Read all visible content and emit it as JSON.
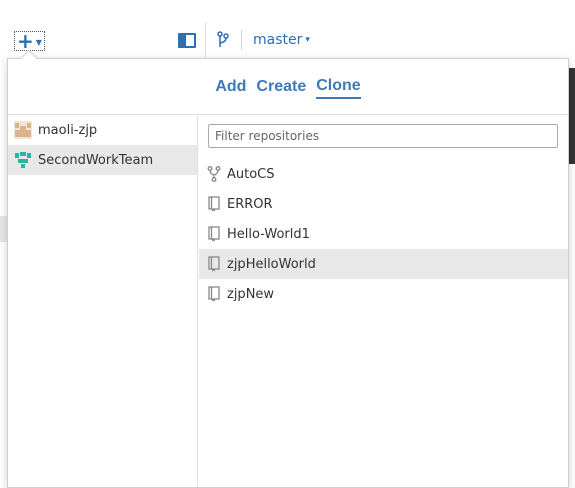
{
  "toolbar": {
    "add_icon": "plus-icon",
    "branch_name": "master",
    "branch_dropdown_glyph": "▾"
  },
  "tabs": [
    {
      "label": "Add",
      "active": false
    },
    {
      "label": "Create",
      "active": false
    },
    {
      "label": "Clone",
      "active": true
    }
  ],
  "owners": [
    {
      "name": "maoli-zjp",
      "avatar_color": "#d9b48a",
      "selected": false
    },
    {
      "name": "SecondWorkTeam",
      "avatar_color": "#2bb3a3",
      "selected": true
    }
  ],
  "filter": {
    "placeholder": "Filter repositories",
    "value": ""
  },
  "repositories": [
    {
      "name": "AutoCS",
      "icon": "fork-icon",
      "selected": false
    },
    {
      "name": "ERROR",
      "icon": "repo-icon",
      "selected": false
    },
    {
      "name": "Hello-World1",
      "icon": "repo-icon",
      "selected": false
    },
    {
      "name": "zjpHelloWorld",
      "icon": "repo-icon",
      "selected": true
    },
    {
      "name": "zjpNew",
      "icon": "repo-icon",
      "selected": false
    }
  ],
  "colors": {
    "accent": "#3d7ab8",
    "selected_row": "#e8e8e8",
    "border": "#cfcfcf"
  }
}
